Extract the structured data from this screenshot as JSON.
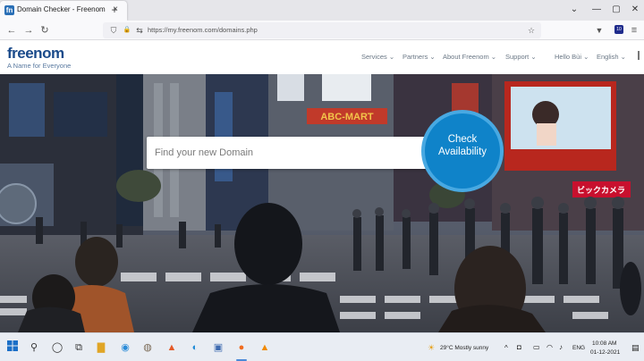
{
  "browser": {
    "tab_title": "Domain Checker - Freenom",
    "tab_favicon_letter": "fn",
    "close_glyph": "×",
    "new_tab_glyph": "+",
    "url": "https://my.freenom.com/domains.php",
    "extension_badge": "10",
    "window_controls": {
      "list": "⌄",
      "minimize": "—",
      "maximize": "▢",
      "close": "✕"
    },
    "nav_glyphs": {
      "back": "←",
      "forward": "→",
      "reload": "↻",
      "shield": "⛉",
      "lock": "🔒",
      "star": "☆",
      "menu": "≡"
    }
  },
  "site": {
    "logo": "freenom",
    "tagline": "A Name for Everyone",
    "menu": [
      {
        "label": "Services ⌄"
      },
      {
        "label": "Partners ⌄"
      },
      {
        "label": "About Freenom ⌄"
      },
      {
        "label": "Support ⌄"
      },
      {
        "label": "Hello Bùi ⌄"
      },
      {
        "label": "English ⌄"
      }
    ]
  },
  "hero": {
    "search_placeholder": "Find your new Domain",
    "check_button": {
      "line1": "Check",
      "line2": "Availability"
    },
    "sign_text": "ABC-MART",
    "billboard_text": "ビックカメラ"
  },
  "taskbar": {
    "weather": "29°C  Mostly sunny",
    "time": "10:08 AM",
    "date": "01-12-2021",
    "lang": "ENG",
    "up_arrow": "^",
    "icons": [
      "windows-icon",
      "search-icon",
      "cortana-icon",
      "task-view-icon",
      "file-explorer-icon",
      "chrome-icon",
      "gimp-icon",
      "brave-icon",
      "edge-icon",
      "photos-icon",
      "firefox-icon",
      "vlc-icon"
    ]
  },
  "colors": {
    "brand": "#1a4a8a",
    "button": "#0f83c9",
    "menu_text": "#6a7785"
  }
}
